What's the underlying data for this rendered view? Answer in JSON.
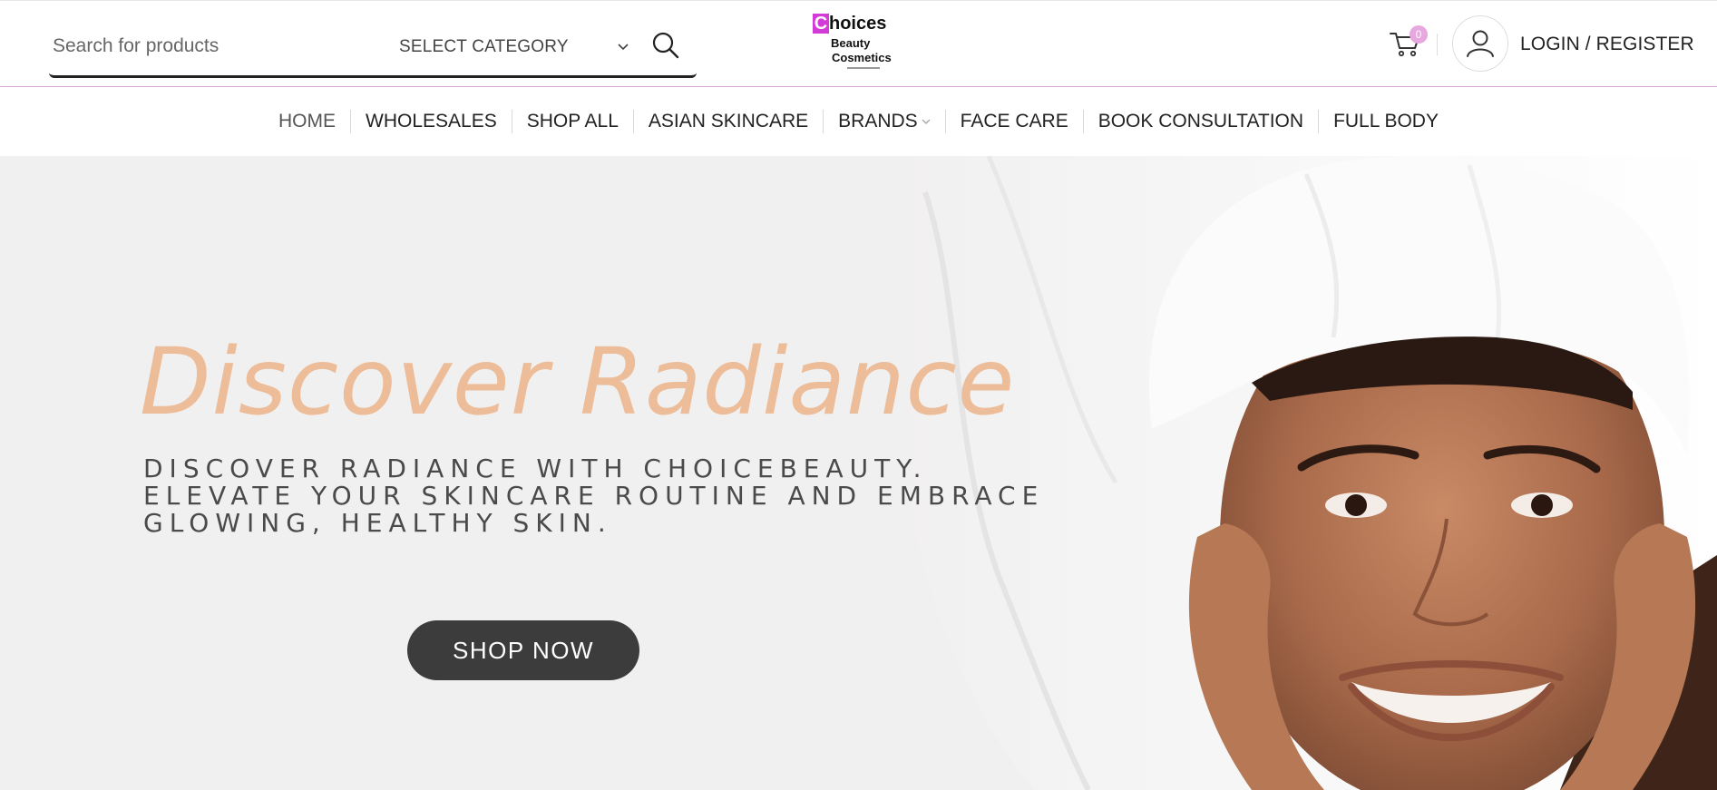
{
  "header": {
    "search": {
      "placeholder": "Search for products",
      "value": ""
    },
    "category": {
      "label": "SELECT CATEGORY"
    },
    "logo": {
      "line1_initial": "C",
      "line1_rest": "hoices",
      "line2": "Beauty",
      "line3": "Cosmetics"
    },
    "cart": {
      "count": "0"
    },
    "login_label": "LOGIN / REGISTER"
  },
  "nav": {
    "items": [
      {
        "label": "HOME"
      },
      {
        "label": "WHOLESALES"
      },
      {
        "label": "SHOP ALL"
      },
      {
        "label": "ASIAN SKINCARE"
      },
      {
        "label": "BRANDS"
      },
      {
        "label": "FACE CARE"
      },
      {
        "label": "BOOK CONSULTATION"
      },
      {
        "label": "FULL BODY"
      }
    ]
  },
  "hero": {
    "title": "Discover Radiance",
    "subtitle_lines": [
      "DISCOVER RADIANCE WITH CHOICEBEAUTY.",
      "ELEVATE YOUR SKINCARE ROUTINE AND EMBRACE",
      "GLOWING, HEALTHY SKIN."
    ],
    "cta_label": "SHOP NOW"
  },
  "colors": {
    "accent_pink": "#d23bd6",
    "title_peach": "#ecbd98",
    "cta_dark": "#3c3c3c",
    "hero_bg": "#f1f0f0"
  },
  "icons": {
    "search": "search-icon",
    "chevron": "chevron-down-icon",
    "cart": "cart-icon",
    "user": "user-icon"
  }
}
